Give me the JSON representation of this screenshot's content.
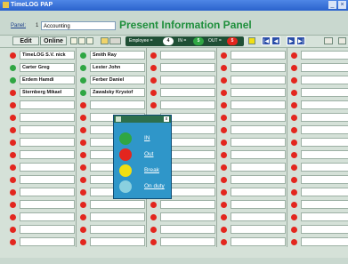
{
  "window": {
    "title": "TimeLOG PAP",
    "minimize": "_",
    "close": "×"
  },
  "panel": {
    "label": "Panel:",
    "number": "1",
    "selected": "Accounting",
    "title": "Present Information Panel"
  },
  "toolbar": {
    "edit_label": "Edit",
    "online_label": "Online",
    "employee_label": "Employee =",
    "employee_count": "4",
    "in_label": "IN =",
    "in_count": "5",
    "out_label": "OUT =",
    "out_count": "5",
    "nav": [
      "|◀",
      "◀",
      "▶",
      "▶|"
    ]
  },
  "colors": {
    "in": "#2fa643",
    "out": "#e3261e",
    "break": "#f1df12",
    "on_duty": "#8ad0df",
    "title_green": "#1f8f3c"
  },
  "grid": {
    "columns": [
      {
        "names": [
          "TimeLOG S.V. nick",
          "Carter Greg",
          "Erdem Hamdi",
          "Sternberg Mikael",
          "",
          "",
          "",
          "",
          "",
          "",
          "",
          "",
          "",
          "",
          "",
          ""
        ],
        "status": [
          "out",
          "in",
          "in",
          "out",
          "out",
          "out",
          "out",
          "out",
          "out",
          "out",
          "out",
          "out",
          "out",
          "out",
          "out",
          "out"
        ]
      },
      {
        "names": [
          "Smith Ray",
          "Lester John",
          "Ferber Daniel",
          "Zawalsky Krystof",
          "",
          "",
          "",
          "",
          "",
          "",
          "",
          "",
          "",
          "",
          "",
          ""
        ],
        "status": [
          "in",
          "in",
          "in",
          "in",
          "out",
          "out",
          "out",
          "out",
          "out",
          "out",
          "out",
          "out",
          "out",
          "out",
          "out",
          "out"
        ]
      },
      {
        "names": [
          "",
          "",
          "",
          "",
          "",
          "",
          "",
          "",
          "",
          "",
          "",
          "",
          "",
          "",
          "",
          ""
        ],
        "status": [
          "out",
          "out",
          "out",
          "out",
          "out",
          "out",
          "out",
          "out",
          "out",
          "out",
          "out",
          "out",
          "out",
          "out",
          "out",
          "out"
        ]
      },
      {
        "names": [
          "",
          "",
          "",
          "",
          "",
          "",
          "",
          "",
          "",
          "",
          "",
          "",
          "",
          "",
          "",
          ""
        ],
        "status": [
          "out",
          "out",
          "out",
          "out",
          "out",
          "out",
          "out",
          "out",
          "out",
          "out",
          "out",
          "out",
          "out",
          "out",
          "out",
          "out"
        ]
      },
      {
        "names": [
          "",
          "",
          "",
          "",
          "",
          "",
          "",
          "",
          "",
          "",
          "",
          "",
          "",
          "",
          "",
          ""
        ],
        "status": [
          "out",
          "out",
          "out",
          "out",
          "out",
          "out",
          "out",
          "out",
          "out",
          "out",
          "out",
          "out",
          "out",
          "out",
          "out",
          "out"
        ]
      }
    ]
  },
  "status_popup": {
    "items": [
      {
        "label": "IN",
        "status": "in"
      },
      {
        "label": "Out",
        "status": "out"
      },
      {
        "label": "Break",
        "status": "break"
      },
      {
        "label": "On duty",
        "status": "on_duty"
      }
    ]
  }
}
